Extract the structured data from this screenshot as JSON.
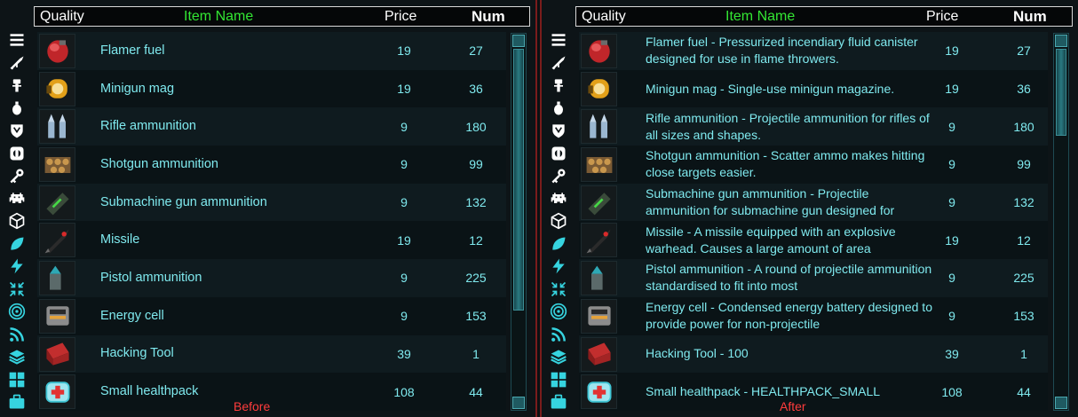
{
  "header": {
    "quality": "Quality",
    "item_name": "Item Name",
    "price": "Price",
    "num": "Num"
  },
  "sidebar_icons": [
    "menu-icon",
    "rifle-icon",
    "torch-icon",
    "grenade-icon",
    "shield-icon",
    "armor-icon",
    "key-icon",
    "invader-icon",
    "box-icon",
    "leaf-icon",
    "lightning-icon",
    "collapse-icon",
    "target-icon",
    "wifi-icon",
    "layers-icon",
    "grid-icon",
    "briefcase-icon"
  ],
  "before": {
    "caption": "Before",
    "items": [
      {
        "icon": "fuel-canister-icon",
        "name": "Flamer fuel",
        "price": "19",
        "num": "27"
      },
      {
        "icon": "minigun-mag-icon",
        "name": "Minigun mag",
        "price": "19",
        "num": "36"
      },
      {
        "icon": "rifle-ammo-icon",
        "name": "Rifle ammunition",
        "price": "9",
        "num": "180"
      },
      {
        "icon": "shotgun-ammo-icon",
        "name": "Shotgun ammunition",
        "price": "9",
        "num": "99"
      },
      {
        "icon": "smg-ammo-icon",
        "name": "Submachine gun ammunition",
        "price": "9",
        "num": "132"
      },
      {
        "icon": "missile-icon",
        "name": "Missile",
        "price": "19",
        "num": "12"
      },
      {
        "icon": "pistol-ammo-icon",
        "name": "Pistol ammunition",
        "price": "9",
        "num": "225"
      },
      {
        "icon": "energy-cell-icon",
        "name": "Energy cell",
        "price": "9",
        "num": "153"
      },
      {
        "icon": "hacking-tool-icon",
        "name": "Hacking Tool",
        "price": "39",
        "num": "1"
      },
      {
        "icon": "healthpack-icon",
        "name": "Small healthpack",
        "price": "108",
        "num": "44"
      }
    ]
  },
  "after": {
    "caption": "After",
    "items": [
      {
        "icon": "fuel-canister-icon",
        "name": "Flamer fuel - Pressurized incendiary fluid canister designed for use in flame throwers.",
        "price": "19",
        "num": "27"
      },
      {
        "icon": "minigun-mag-icon",
        "name": "Minigun mag - Single-use minigun magazine.",
        "price": "19",
        "num": "36"
      },
      {
        "icon": "rifle-ammo-icon",
        "name": "Rifle ammunition - Projectile ammunition for rifles of all sizes and shapes.",
        "price": "9",
        "num": "180"
      },
      {
        "icon": "shotgun-ammo-icon",
        "name": "Shotgun ammunition - Scatter ammo makes hitting close targets easier.",
        "price": "9",
        "num": "99"
      },
      {
        "icon": "smg-ammo-icon",
        "name": "Submachine gun ammunition - Projectile ammunition for submachine gun designed for",
        "price": "9",
        "num": "132"
      },
      {
        "icon": "missile-icon",
        "name": "Missile - A missile equipped with an explosive warhead. Causes a large amount of area",
        "price": "19",
        "num": "12"
      },
      {
        "icon": "pistol-ammo-icon",
        "name": "Pistol ammunition - A round of projectile ammunition standardised to fit into most",
        "price": "9",
        "num": "225"
      },
      {
        "icon": "energy-cell-icon",
        "name": "Energy cell - Condensed energy battery designed to provide power for non-projectile",
        "price": "9",
        "num": "153"
      },
      {
        "icon": "hacking-tool-icon",
        "name": "Hacking Tool - 100",
        "price": "39",
        "num": "1"
      },
      {
        "icon": "healthpack-icon",
        "name": "Small healthpack - HEALTHPACK_SMALL",
        "price": "108",
        "num": "44"
      }
    ]
  },
  "colors": {
    "accent_green": "#33e633",
    "text_cyan": "#7fe9ee",
    "caption_red": "#ff3c3c",
    "divider_red": "#7a1c1c"
  }
}
